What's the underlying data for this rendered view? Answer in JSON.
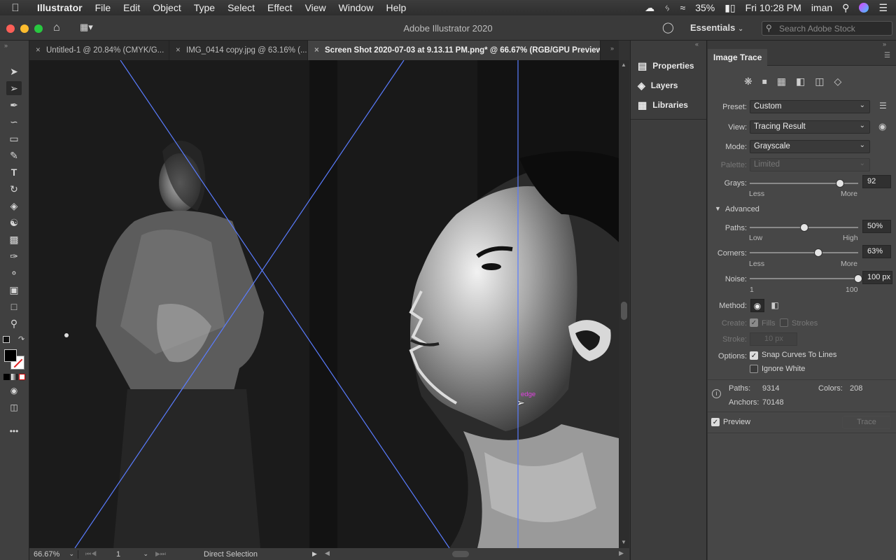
{
  "menubar": {
    "app": "Illustrator",
    "items": [
      "File",
      "Edit",
      "Object",
      "Type",
      "Select",
      "Effect",
      "View",
      "Window",
      "Help"
    ],
    "battery": "35%",
    "clock": "Fri 10:28 PM",
    "user": "iman"
  },
  "titlebar": {
    "title": "Adobe Illustrator 2020",
    "workspace": "Essentials",
    "search_placeholder": "Search Adobe Stock"
  },
  "tabs": [
    {
      "label": "Untitled-1 @ 20.84% (CMYK/G..."
    },
    {
      "label": "IMG_0414 copy.jpg @ 63.16% (..."
    },
    {
      "label": "Screen Shot 2020-07-03 at 9.13.11 PM.png* @ 66.67% (RGB/GPU Preview)"
    }
  ],
  "canvas": {
    "cursor_label": "edge"
  },
  "status": {
    "zoom": "66.67%",
    "artboard": "1",
    "tool": "Direct Selection"
  },
  "side_panels": {
    "properties": "Properties",
    "layers": "Layers",
    "libraries": "Libraries"
  },
  "image_trace": {
    "panel_title": "Image Trace",
    "preset_label": "Preset:",
    "preset_value": "Custom",
    "view_label": "View:",
    "view_value": "Tracing Result",
    "mode_label": "Mode:",
    "mode_value": "Grayscale",
    "palette_label": "Palette:",
    "palette_value": "Limited",
    "grays_label": "Grays:",
    "grays_value": "92",
    "grays_fraction": 0.83,
    "grays_min": "Less",
    "grays_max": "More",
    "advanced_label": "Advanced",
    "paths_label": "Paths:",
    "paths_value": "50%",
    "paths_fraction": 0.5,
    "paths_min": "Low",
    "paths_max": "High",
    "corners_label": "Corners:",
    "corners_value": "63%",
    "corners_fraction": 0.63,
    "corners_min": "Less",
    "corners_max": "More",
    "noise_label": "Noise:",
    "noise_value": "100 px",
    "noise_fraction": 1.0,
    "noise_min": "1",
    "noise_max": "100",
    "method_label": "Method:",
    "create_label": "Create:",
    "fills_label": "Fills",
    "strokes_label": "Strokes",
    "stroke_label": "Stroke:",
    "stroke_value": "10 px",
    "options_label": "Options:",
    "snap_label": "Snap Curves To Lines",
    "ignore_white_label": "Ignore White",
    "stats": {
      "paths_label": "Paths:",
      "paths": "9314",
      "colors_label": "Colors:",
      "colors": "208",
      "anchors_label": "Anchors:",
      "anchors": "70148"
    },
    "preview_label": "Preview",
    "trace_button": "Trace"
  }
}
